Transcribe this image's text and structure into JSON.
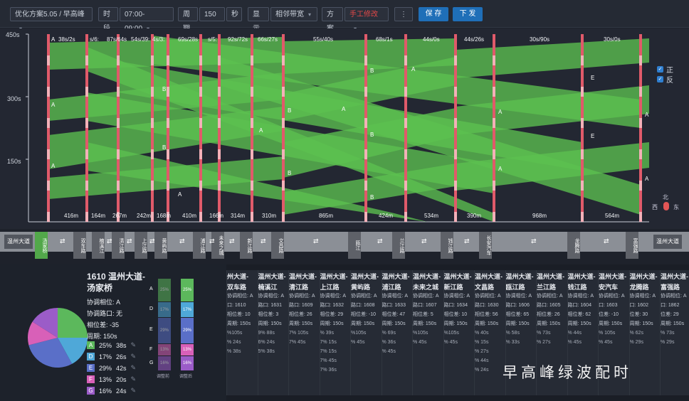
{
  "toolbar": {
    "plan_select": "优化方案5.05 / 早高峰",
    "period_label": "时段",
    "period_value": "07:00-09:00",
    "cycle_label": "周期",
    "cycle_value": "150",
    "cycle_unit": "秒",
    "display_label": "显示",
    "display_value": "相邻带宽",
    "scheme_label": "方案",
    "scheme_value": "手工修改",
    "more_label": "⋮",
    "save_label": "保 存",
    "send_label": "下 发"
  },
  "chart": {
    "y_ticks": [
      "450s",
      "300s",
      "150s"
    ],
    "legend": [
      {
        "label": "正",
        "checked": true
      },
      {
        "label": "反",
        "checked": true
      }
    ],
    "band_top_labels": [
      "38s/2s",
      "s/6:",
      "87s/64s",
      "54s/39:",
      "4s/3:",
      "69s/28s",
      "s/5:",
      "92s/72s",
      "66s/27s",
      "55s/40s",
      "68s/1s",
      "44s/0s",
      "44s/26s",
      "30s/90s",
      "30s/0s"
    ],
    "distances": [
      "416m",
      "164m",
      "267m",
      "242m",
      "168m",
      "410m",
      "166m",
      "314m",
      "310m",
      "865m",
      "424m",
      "534m",
      "390m",
      "968m",
      "564m"
    ],
    "compass": {
      "n": "北",
      "w": "西",
      "e": "东"
    },
    "colors": {
      "band": "#5cc04f",
      "signal_red": "#e05a6a",
      "bg": "#232732"
    }
  },
  "road": {
    "left_end": "温州大道",
    "right_end": "温州大道",
    "intersections": [
      "汤家桥",
      "双车路",
      "楠溪江",
      "清江路",
      "上江路",
      "黄屿路",
      "浦江路",
      "未来之城",
      "新江路",
      "文昌路",
      "瓯江",
      "兰江路",
      "钱江路",
      "长安汽车",
      "龙腾路",
      "富强路"
    ],
    "arrow_glyph": "⇄"
  },
  "detail": {
    "title_line1": "1610 温州大道-",
    "title_line2": "汤家桥",
    "coord_phase": "协调相位: A",
    "coord_inlet": "协调路口: 无",
    "offset": "相位差: -35",
    "cycle": "周期: 150s",
    "phases": [
      {
        "tag": "A",
        "pct": "25%",
        "sec": "38s",
        "color": "#5cb85c"
      },
      {
        "tag": "D",
        "pct": "17%",
        "sec": "26s",
        "color": "#4fa8d8"
      },
      {
        "tag": "E",
        "pct": "29%",
        "sec": "42s",
        "color": "#5a6fc8"
      },
      {
        "tag": "F",
        "pct": "13%",
        "sec": "20s",
        "color": "#d860b8"
      },
      {
        "tag": "G",
        "pct": "16%",
        "sec": "24s",
        "color": "#9b5cc8"
      }
    ],
    "bar_labels": [
      "A",
      "D",
      "E",
      "F",
      "G"
    ],
    "bar_left_pct": [
      "25%",
      "17%",
      "29%",
      "13%",
      "16%"
    ],
    "bar_right_pct": [
      "25%",
      "17%",
      "29%",
      "13%",
      "16%"
    ],
    "bar_foot_left": "调整前",
    "bar_foot_right": "调整后"
  },
  "cards": [
    {
      "t": "州大道-",
      "t2": "双车路",
      "a": "协调相位: A",
      "b": "口: 1610",
      "c": "相位差: 10",
      "d": "周期: 150s",
      "p": [
        "%105s",
        "% 24s",
        "% 38s"
      ]
    },
    {
      "t": "温州大道-",
      "t2": "楠溪江",
      "a": "协调相位: A",
      "b": "路口: 1631",
      "c": "相位差: 3",
      "d": "周期: 150s",
      "p": [
        "9% 88s",
        "6% 24s",
        "5% 38s"
      ]
    },
    {
      "t": "温州大道-",
      "t2": "清江路",
      "a": "协调相位: A",
      "b": "路口: 1609",
      "c": "相位差: 26",
      "d": "周期: 150s",
      "p": [
        "7% 105s",
        "7% 45s"
      ]
    },
    {
      "t": "温州大道-",
      "t2": "上江路",
      "a": "协调相位: A",
      "b": "路口: 1632",
      "c": "相位差: 29",
      "d": "周期: 150s",
      "p": [
        "% 39s",
        "7% 15s",
        "7% 15s",
        "7% 45s",
        "7% 36s"
      ]
    },
    {
      "t": "温州大道-",
      "t2": "黄屿路",
      "a": "协调相位: A",
      "b": "路口: 1608",
      "c": "相位差: -10",
      "d": "周期: 150s",
      "p": [
        "%105s",
        "% 45s"
      ]
    },
    {
      "t": "温州大道-",
      "t2": "浦江路",
      "a": "协调相位: A",
      "b": "路口: 1633",
      "c": "相位差: 47",
      "d": "周期: 150s",
      "p": [
        "% 69s",
        "% 36s",
        "% 45s"
      ]
    },
    {
      "t": "温州大道-",
      "t2": "未来之城",
      "a": "协调相位: A",
      "b": "路口: 1607",
      "c": "相位差: 5",
      "d": "周期: 150s",
      "p": [
        "%105s",
        "% 45s"
      ]
    },
    {
      "t": "温州大道-",
      "t2": "新江路",
      "a": "协调相位: A",
      "b": "路口: 1634",
      "c": "相位差: 10",
      "d": "周期: 150s",
      "p": [
        "%105s",
        "% 45s"
      ]
    },
    {
      "t": "温州大道-",
      "t2": "文昌路",
      "a": "协调相位: A",
      "b": "路口: 1630",
      "c": "相位差: 56",
      "d": "周期: 150s",
      "p": [
        "% 40s",
        "% 15s",
        "% 27s",
        "% 44s",
        "% 24s"
      ]
    },
    {
      "t": "温州大道-",
      "t2": "瓯江路",
      "a": "协调相位: A",
      "b": "路口: 1606",
      "c": "相位差: 65",
      "d": "周期: 150s",
      "p": [
        "% 58s",
        "% 33s"
      ]
    },
    {
      "t": "温州大道-",
      "t2": "兰江路",
      "a": "协调相位: A",
      "b": "路口: 1605",
      "c": "相位差: 26",
      "d": "周期: 150s",
      "p": [
        "% 73s",
        "% 27s"
      ]
    },
    {
      "t": "温州大道-",
      "t2": "钱江路",
      "a": "协调相位: A",
      "b": "路口: 1604",
      "c": "相位差: 62",
      "d": "周期: 150s",
      "p": [
        "% 44s",
        "% 45s"
      ]
    },
    {
      "t": "温州大道-",
      "t2": "安汽车",
      "a": "协调相位: A",
      "b": "口: 1603",
      "c": "位差: -10",
      "d": "周期: 150s",
      "p": [
        "% 105s",
        "% 45s"
      ]
    },
    {
      "t": "温州大道-",
      "t2": "龙腾路",
      "a": "协调相位: A",
      "b": "口: 1602",
      "c": "位差: 30",
      "d": "周期: 150s",
      "p": [
        "% 62s",
        "% 29s"
      ]
    },
    {
      "t": "温州大道-",
      "t2": "富强路",
      "a": "协调相位: A",
      "b": "口: 1862",
      "c": "位差: 29",
      "d": "周期: 150s",
      "p": [
        "% 73s",
        "% 29s"
      ]
    }
  ],
  "watermark": "早高峰绿波配时"
}
